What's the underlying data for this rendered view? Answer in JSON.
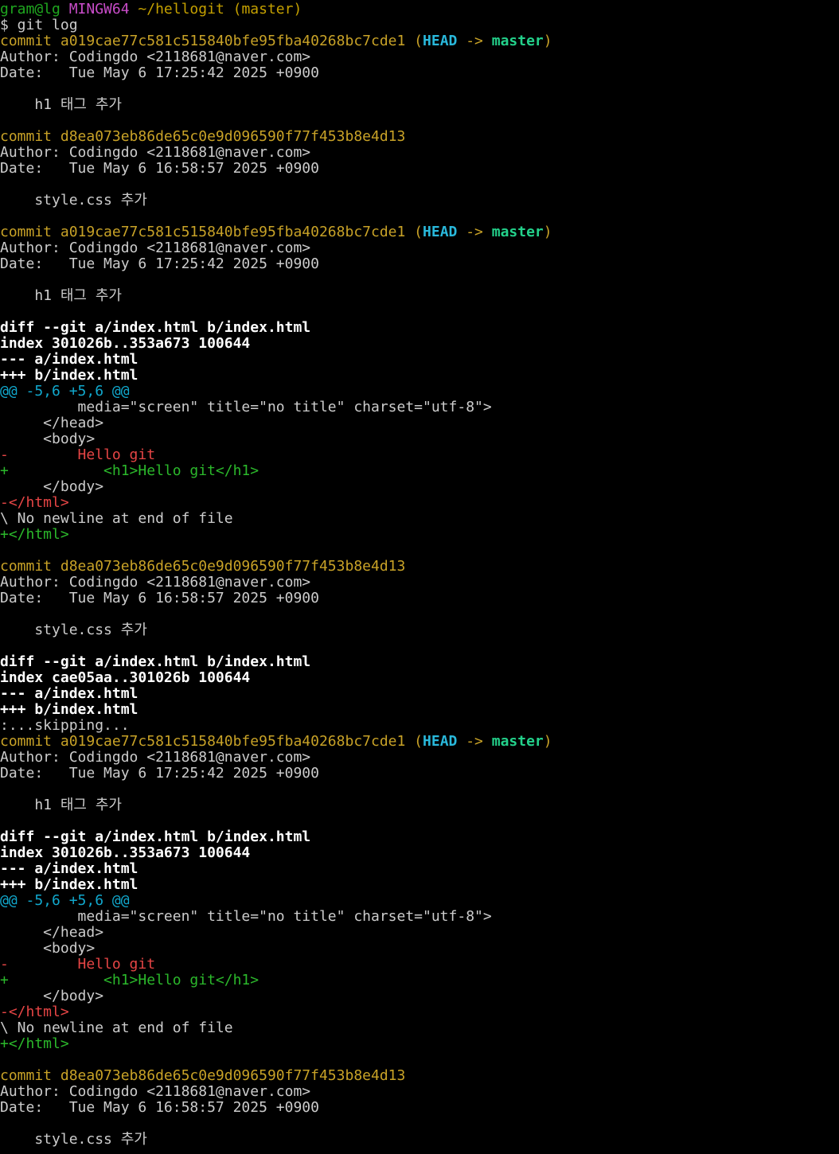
{
  "colors": {
    "background": "#000000",
    "default": "#cccccc",
    "bold_white": "#ffffff",
    "prompt_green": "#1fa61f",
    "prompt_magenta": "#c84cc8",
    "prompt_yellow": "#c4a000",
    "commit_yellow": "#c8a227",
    "head_cyan": "#29b8db",
    "branch_green": "#23d18b",
    "hunk_cyan": "#11a8cd",
    "removed_red": "#e64545",
    "added_green": "#2bb82b"
  },
  "terminal": {
    "lines": [
      [
        {
          "t": "gram@lg",
          "c": "prompt_green"
        },
        {
          "t": " "
        },
        {
          "t": "MINGW64",
          "c": "prompt_magenta"
        },
        {
          "t": " "
        },
        {
          "t": "~/hellogit",
          "c": "prompt_yellow"
        },
        {
          "t": " (master)",
          "c": "prompt_yellow"
        }
      ],
      [
        {
          "t": "$ git log"
        }
      ],
      [
        {
          "t": "commit a019cae77c581c515840bfe95fba40268bc7cde1 (",
          "c": "commit_yellow"
        },
        {
          "t": "HEAD",
          "c": "head_cyan",
          "b": true
        },
        {
          "t": " -> ",
          "c": "commit_yellow"
        },
        {
          "t": "master",
          "c": "branch_green",
          "b": true
        },
        {
          "t": ")",
          "c": "commit_yellow"
        }
      ],
      [
        {
          "t": "Author: Codingdo <2118681@naver.com>"
        }
      ],
      [
        {
          "t": "Date:   Tue May 6 17:25:42 2025 +0900"
        }
      ],
      [],
      [
        {
          "t": "    h1 태그 추가"
        }
      ],
      [],
      [
        {
          "t": "commit d8ea073eb86de65c0e9d096590f77f453b8e4d13",
          "c": "commit_yellow"
        }
      ],
      [
        {
          "t": "Author: Codingdo <2118681@naver.com>"
        }
      ],
      [
        {
          "t": "Date:   Tue May 6 16:58:57 2025 +0900"
        }
      ],
      [],
      [
        {
          "t": "    style.css 추가"
        }
      ],
      [],
      [
        {
          "t": "commit a019cae77c581c515840bfe95fba40268bc7cde1 (",
          "c": "commit_yellow"
        },
        {
          "t": "HEAD",
          "c": "head_cyan",
          "b": true
        },
        {
          "t": " -> ",
          "c": "commit_yellow"
        },
        {
          "t": "master",
          "c": "branch_green",
          "b": true
        },
        {
          "t": ")",
          "c": "commit_yellow"
        }
      ],
      [
        {
          "t": "Author: Codingdo <2118681@naver.com>"
        }
      ],
      [
        {
          "t": "Date:   Tue May 6 17:25:42 2025 +0900"
        }
      ],
      [],
      [
        {
          "t": "    h1 태그 추가"
        }
      ],
      [],
      [
        {
          "t": "diff --git a/index.html b/index.html",
          "c": "bold_white",
          "b": true
        }
      ],
      [
        {
          "t": "index 301026b..353a673 100644",
          "c": "bold_white",
          "b": true
        }
      ],
      [
        {
          "t": "--- a/index.html",
          "c": "bold_white",
          "b": true
        }
      ],
      [
        {
          "t": "+++ b/index.html",
          "c": "bold_white",
          "b": true
        }
      ],
      [
        {
          "t": "@@ -5,6 +5,6 @@",
          "c": "hunk_cyan"
        }
      ],
      [
        {
          "t": "         media=\"screen\" title=\"no title\" charset=\"utf-8\">"
        }
      ],
      [
        {
          "t": "     </head>"
        }
      ],
      [
        {
          "t": "     <body>"
        }
      ],
      [
        {
          "t": "-        Hello git",
          "c": "removed_red"
        }
      ],
      [
        {
          "t": "+           <h1>Hello git</h1>",
          "c": "added_green"
        }
      ],
      [
        {
          "t": "     </body>"
        }
      ],
      [
        {
          "t": "-</html>",
          "c": "removed_red"
        }
      ],
      [
        {
          "t": "\\ No newline at end of file"
        }
      ],
      [
        {
          "t": "+</html>",
          "c": "added_green"
        }
      ],
      [],
      [
        {
          "t": "commit d8ea073eb86de65c0e9d096590f77f453b8e4d13",
          "c": "commit_yellow"
        }
      ],
      [
        {
          "t": "Author: Codingdo <2118681@naver.com>"
        }
      ],
      [
        {
          "t": "Date:   Tue May 6 16:58:57 2025 +0900"
        }
      ],
      [],
      [
        {
          "t": "    style.css 추가"
        }
      ],
      [],
      [
        {
          "t": "diff --git a/index.html b/index.html",
          "c": "bold_white",
          "b": true
        }
      ],
      [
        {
          "t": "index cae05aa..301026b 100644",
          "c": "bold_white",
          "b": true
        }
      ],
      [
        {
          "t": "--- a/index.html",
          "c": "bold_white",
          "b": true
        }
      ],
      [
        {
          "t": "+++ b/index.html",
          "c": "bold_white",
          "b": true
        }
      ],
      [
        {
          "t": ":...skipping..."
        }
      ],
      [
        {
          "t": "commit a019cae77c581c515840bfe95fba40268bc7cde1 (",
          "c": "commit_yellow"
        },
        {
          "t": "HEAD",
          "c": "head_cyan",
          "b": true
        },
        {
          "t": " -> ",
          "c": "commit_yellow"
        },
        {
          "t": "master",
          "c": "branch_green",
          "b": true
        },
        {
          "t": ")",
          "c": "commit_yellow"
        }
      ],
      [
        {
          "t": "Author: Codingdo <2118681@naver.com>"
        }
      ],
      [
        {
          "t": "Date:   Tue May 6 17:25:42 2025 +0900"
        }
      ],
      [],
      [
        {
          "t": "    h1 태그 추가"
        }
      ],
      [],
      [
        {
          "t": "diff --git a/index.html b/index.html",
          "c": "bold_white",
          "b": true
        }
      ],
      [
        {
          "t": "index 301026b..353a673 100644",
          "c": "bold_white",
          "b": true
        }
      ],
      [
        {
          "t": "--- a/index.html",
          "c": "bold_white",
          "b": true
        }
      ],
      [
        {
          "t": "+++ b/index.html",
          "c": "bold_white",
          "b": true
        }
      ],
      [
        {
          "t": "@@ -5,6 +5,6 @@",
          "c": "hunk_cyan"
        }
      ],
      [
        {
          "t": "         media=\"screen\" title=\"no title\" charset=\"utf-8\">"
        }
      ],
      [
        {
          "t": "     </head>"
        }
      ],
      [
        {
          "t": "     <body>"
        }
      ],
      [
        {
          "t": "-        Hello git",
          "c": "removed_red"
        }
      ],
      [
        {
          "t": "+           <h1>Hello git</h1>",
          "c": "added_green"
        }
      ],
      [
        {
          "t": "     </body>"
        }
      ],
      [
        {
          "t": "-</html>",
          "c": "removed_red"
        }
      ],
      [
        {
          "t": "\\ No newline at end of file"
        }
      ],
      [
        {
          "t": "+</html>",
          "c": "added_green"
        }
      ],
      [],
      [
        {
          "t": "commit d8ea073eb86de65c0e9d096590f77f453b8e4d13",
          "c": "commit_yellow"
        }
      ],
      [
        {
          "t": "Author: Codingdo <2118681@naver.com>"
        }
      ],
      [
        {
          "t": "Date:   Tue May 6 16:58:57 2025 +0900"
        }
      ],
      [],
      [
        {
          "t": "    style.css 추가"
        }
      ]
    ]
  }
}
